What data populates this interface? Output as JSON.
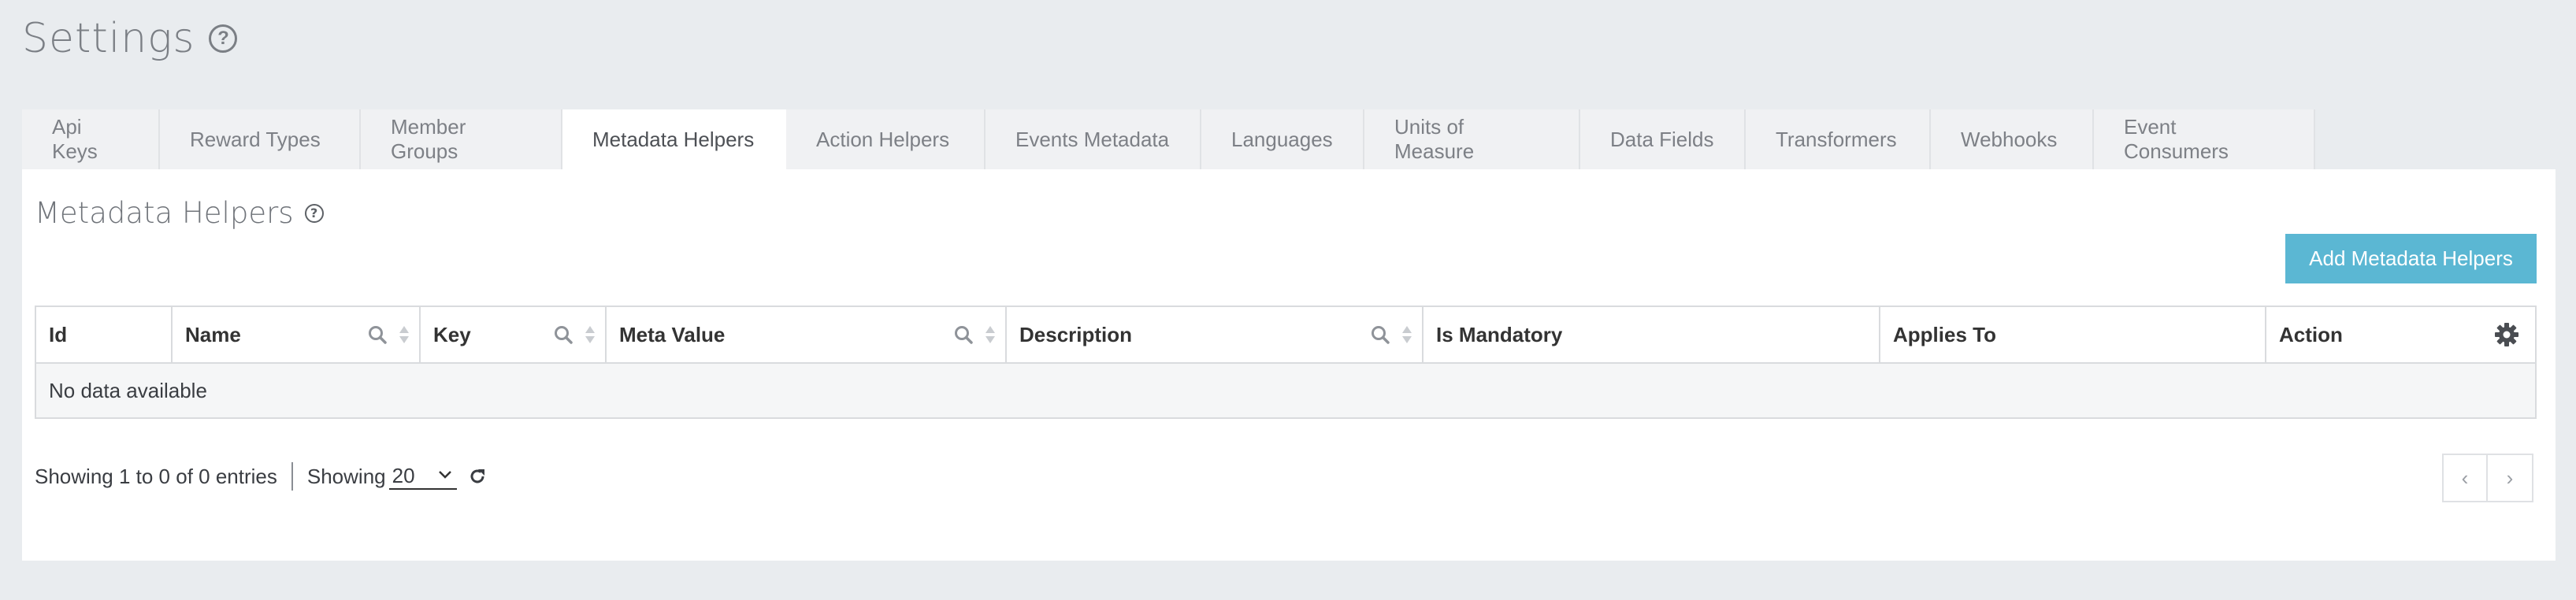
{
  "page": {
    "title": "Settings",
    "help_glyph": "?"
  },
  "tabs": [
    {
      "label": "Api Keys",
      "active": false
    },
    {
      "label": "Reward Types",
      "active": false
    },
    {
      "label": "Member Groups",
      "active": false
    },
    {
      "label": "Metadata Helpers",
      "active": true
    },
    {
      "label": "Action Helpers",
      "active": false
    },
    {
      "label": "Events Metadata",
      "active": false
    },
    {
      "label": "Languages",
      "active": false
    },
    {
      "label": "Units of Measure",
      "active": false
    },
    {
      "label": "Data Fields",
      "active": false
    },
    {
      "label": "Transformers",
      "active": false
    },
    {
      "label": "Webhooks",
      "active": false
    },
    {
      "label": "Event Consumers",
      "active": false
    }
  ],
  "section": {
    "title": "Metadata Helpers",
    "help_glyph": "?",
    "add_button": "Add Metadata Helpers"
  },
  "table": {
    "columns": [
      {
        "label": "Id",
        "searchable": false,
        "sortable": false
      },
      {
        "label": "Name",
        "searchable": true,
        "sortable": true
      },
      {
        "label": "Key",
        "searchable": true,
        "sortable": true
      },
      {
        "label": "Meta Value",
        "searchable": true,
        "sortable": true
      },
      {
        "label": "Description",
        "searchable": true,
        "sortable": true
      },
      {
        "label": "Is Mandatory",
        "searchable": false,
        "sortable": false
      },
      {
        "label": "Applies To",
        "searchable": false,
        "sortable": false
      },
      {
        "label": "Action",
        "searchable": false,
        "sortable": false,
        "icon": "gear-icon"
      }
    ],
    "empty_message": "No data available"
  },
  "footer": {
    "entries_text": "Showing 1 to 0 of 0 entries",
    "page_size_label": "Showing",
    "page_size_value": "20",
    "prev": "‹",
    "next": "›"
  },
  "colors": {
    "accent": "#5bb7d3",
    "background": "#e9ecef"
  }
}
